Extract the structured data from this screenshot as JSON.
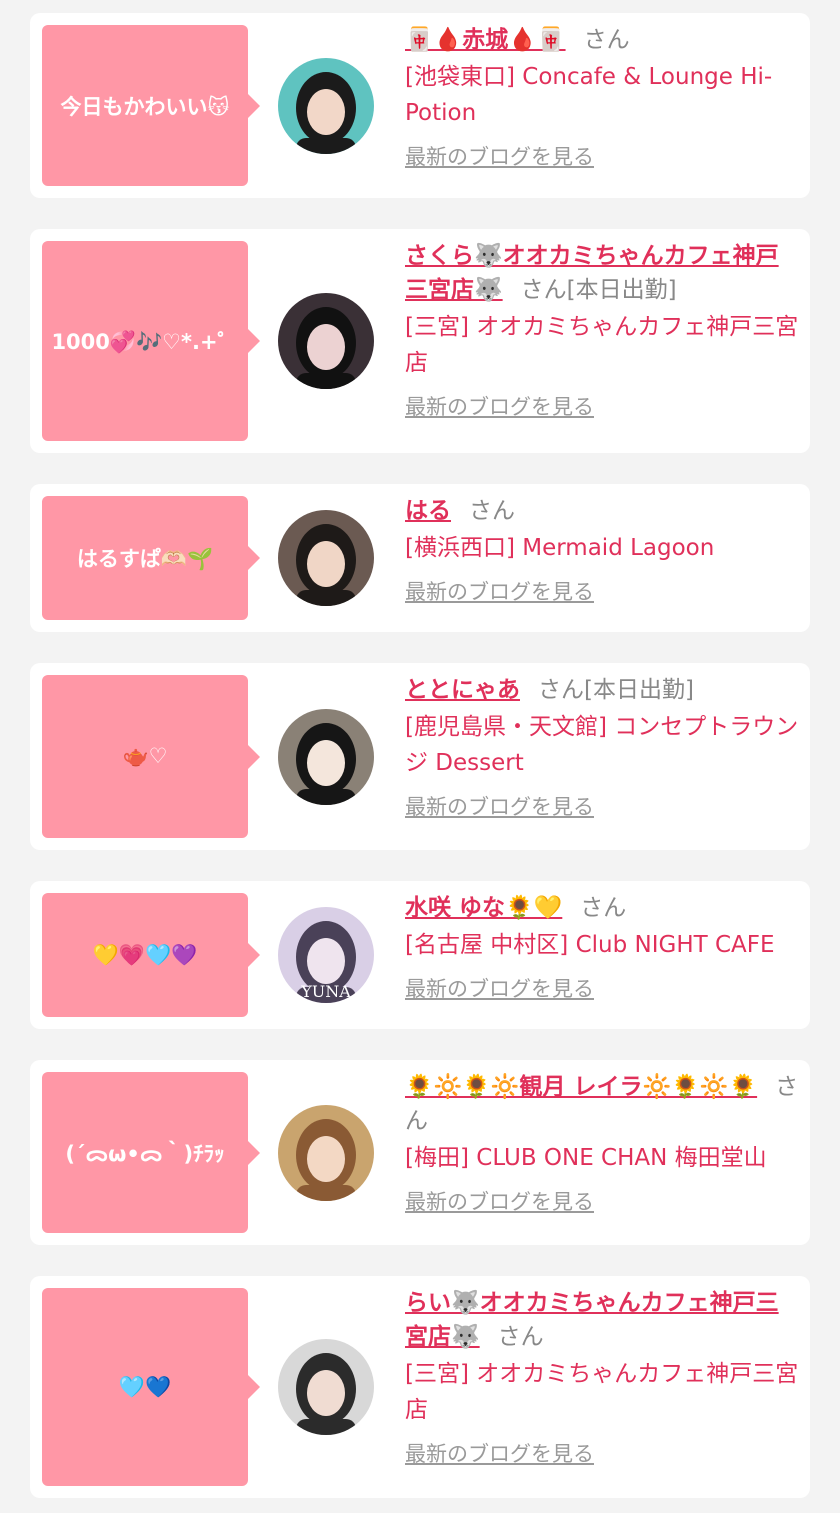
{
  "accent_color": "#e0305a",
  "bubble_color": "#ff97a6",
  "cards": [
    {
      "message": "今日もかわいい😽",
      "name": "🀄🩸赤城🩸🀄",
      "honorific": "さん",
      "status": "",
      "shop": "[池袋東口] Concafe & Lounge Hi-Potion",
      "blog_link": "最新のブログを見る",
      "avatar_colors": [
        "#5fc3c0",
        "#1b1b1b",
        "#f2d7c8"
      ]
    },
    {
      "message": "1000💞🎶♡*.+゜",
      "name": "さくら🐺オオカミちゃんカフェ神戸三宮店🐺",
      "honorific": "さん",
      "status": "[本日出勤]",
      "shop": "[三宮] オオカミちゃんカフェ神戸三宮店",
      "blog_link": "最新のブログを見る",
      "avatar_colors": [
        "#3a3036",
        "#111111",
        "#ecd2d2"
      ]
    },
    {
      "message": "はるすぱ🫶🏻🌱",
      "name": "はる",
      "honorific": "さん",
      "status": "",
      "shop": "[横浜西口] Mermaid Lagoon",
      "blog_link": "最新のブログを見る",
      "avatar_colors": [
        "#6b5a52",
        "#1e1a18",
        "#f0d6c6"
      ]
    },
    {
      "message": "🫖♡",
      "name": "ととにゃあ",
      "honorific": "さん",
      "status": "[本日出勤]",
      "shop": "[鹿児島県・天文館] コンセプトラウンジ Dessert",
      "blog_link": "最新のブログを見る",
      "avatar_colors": [
        "#8a8176",
        "#161616",
        "#f4e6dc"
      ]
    },
    {
      "message": "💛💗🩵💜",
      "name": "水咲 ゆな🌻💛",
      "honorific": "さん",
      "status": "",
      "shop": "[名古屋 中村区] Club NIGHT CAFE",
      "blog_link": "最新のブログを見る",
      "avatar_colors": [
        "#d9cfe6",
        "#4a4158",
        "#efe4ee"
      ],
      "avatar_text": "YUNA"
    },
    {
      "message": "(´ᯅω•ᯅ｀)ﾁﾗｯ",
      "name": "🌻🔆🌻🔆観月 レイラ🔆🌻🔆🌻",
      "honorific": "さん",
      "status": "",
      "shop": "[梅田] CLUB ONE CHAN 梅田堂山",
      "blog_link": "最新のブログを見る",
      "avatar_colors": [
        "#c9a46e",
        "#8a5a34",
        "#f3d8c4"
      ]
    },
    {
      "message": "🩵💙",
      "name": "らい🐺オオカミちゃんカフェ神戸三宮店🐺",
      "honorific": "さん",
      "status": "",
      "shop": "[三宮] オオカミちゃんカフェ神戸三宮店",
      "blog_link": "最新のブログを見る",
      "avatar_colors": [
        "#d8d8d8",
        "#2b2b2b",
        "#f0dcd2"
      ]
    }
  ]
}
